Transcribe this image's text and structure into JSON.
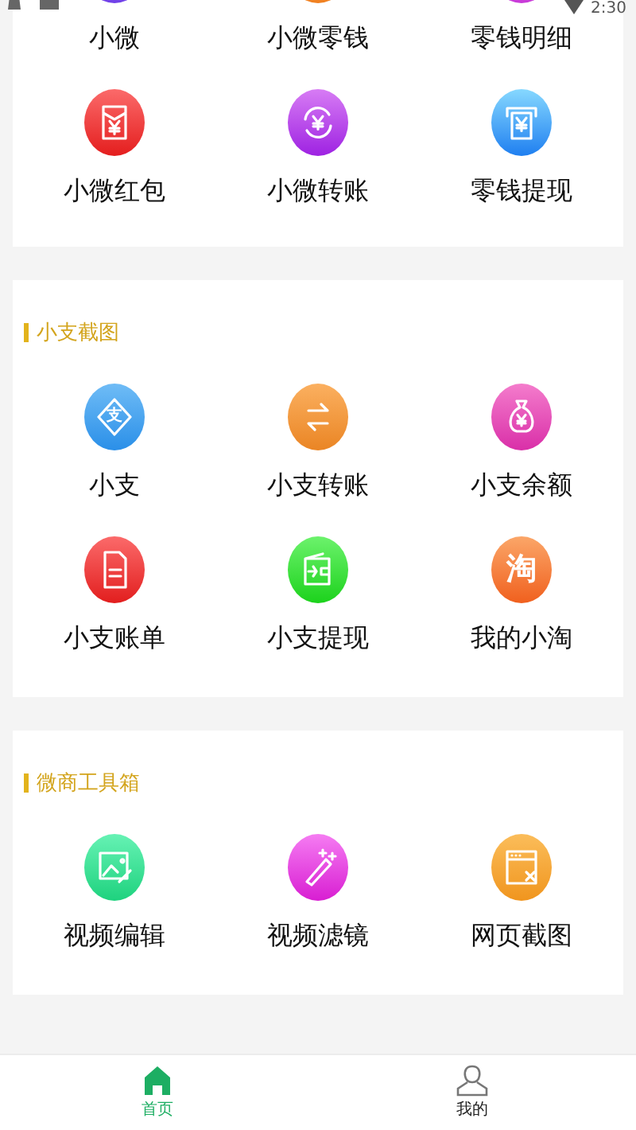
{
  "status_bar": {
    "time": "2:30"
  },
  "sections": [
    {
      "items": [
        {
          "label": "小微"
        },
        {
          "label": "小微零钱"
        },
        {
          "label": "零钱明细"
        },
        {
          "label": "小微红包"
        },
        {
          "label": "小微转账"
        },
        {
          "label": "零钱提现"
        }
      ]
    },
    {
      "title": "小支截图",
      "items": [
        {
          "label": "小支",
          "glyph": "支"
        },
        {
          "label": "小支转账"
        },
        {
          "label": "小支余额"
        },
        {
          "label": "小支账单"
        },
        {
          "label": "小支提现"
        },
        {
          "label": "我的小淘",
          "glyph": "淘"
        }
      ]
    },
    {
      "title": "微商工具箱",
      "items": [
        {
          "label": "视频编辑"
        },
        {
          "label": "视频滤镜"
        },
        {
          "label": "网页截图"
        }
      ]
    }
  ],
  "tabs": [
    {
      "label": "首页",
      "selected": true
    },
    {
      "label": "我的",
      "selected": false
    }
  ]
}
